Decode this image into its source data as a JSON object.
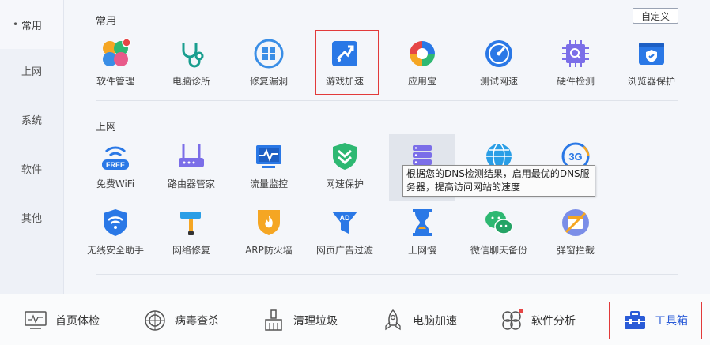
{
  "sidebar": {
    "items": [
      {
        "label": "常用",
        "active": true
      },
      {
        "label": "上网",
        "active": false
      },
      {
        "label": "系统",
        "active": false
      },
      {
        "label": "软件",
        "active": false
      },
      {
        "label": "其他",
        "active": false
      }
    ]
  },
  "main": {
    "custom_label": "自定义",
    "sections": [
      {
        "title": "常用",
        "tools": [
          {
            "label": "软件管理",
            "icon": "clover-icon"
          },
          {
            "label": "电脑诊所",
            "icon": "stethoscope-icon"
          },
          {
            "label": "修复漏洞",
            "icon": "windows-repair-icon"
          },
          {
            "label": "游戏加速",
            "icon": "game-boost-icon",
            "highlighted_red": true
          },
          {
            "label": "应用宝",
            "icon": "app-store-icon"
          },
          {
            "label": "测试网速",
            "icon": "speedometer-icon"
          },
          {
            "label": "硬件检测",
            "icon": "chip-icon"
          },
          {
            "label": "浏览器保护",
            "icon": "browser-shield-icon"
          }
        ]
      },
      {
        "title": "上网",
        "tools_row1": [
          {
            "label": "免费WiFi",
            "icon": "free-wifi-icon"
          },
          {
            "label": "路由器管家",
            "icon": "router-icon"
          },
          {
            "label": "流量监控",
            "icon": "monitor-icon"
          },
          {
            "label": "网速保护",
            "icon": "speed-shield-icon"
          },
          {
            "label": "",
            "icon": "dns-server-icon",
            "hovered": true
          },
          {
            "label": "",
            "icon": "globe-icon"
          },
          {
            "label": "",
            "icon": "3g-icon"
          }
        ],
        "tools_row2": [
          {
            "label": "无线安全助手",
            "icon": "wifi-shield-icon"
          },
          {
            "label": "网络修复",
            "icon": "hammer-icon"
          },
          {
            "label": "ARP防火墙",
            "icon": "firewall-icon"
          },
          {
            "label": "网页广告过滤",
            "icon": "ad-filter-icon"
          },
          {
            "label": "上网慢",
            "icon": "hourglass-icon"
          },
          {
            "label": "微信聊天备份",
            "icon": "wechat-icon"
          },
          {
            "label": "弹窗拦截",
            "icon": "popup-block-icon"
          }
        ]
      }
    ],
    "tooltip": "根据您的DNS检测结果，启用最优的DNS服务器，提高访问网站的速度",
    "tooltip_line1": "根据您的DNS检测结果，启用最优的DNS服",
    "tooltip_line2": "务器，提高访问网站的速度",
    "extra_3g": "3G"
  },
  "bottom_nav": [
    {
      "label": "首页体检",
      "icon": "checkup-icon"
    },
    {
      "label": "病毒查杀",
      "icon": "virus-scan-icon"
    },
    {
      "label": "清理垃圾",
      "icon": "broom-icon"
    },
    {
      "label": "电脑加速",
      "icon": "rocket-icon"
    },
    {
      "label": "软件分析",
      "icon": "pinwheel-icon"
    },
    {
      "label": "工具箱",
      "icon": "toolbox-icon",
      "active": true
    }
  ],
  "colors": {
    "accent": "#2a5bd7",
    "highlight_border": "#e23a3a"
  }
}
